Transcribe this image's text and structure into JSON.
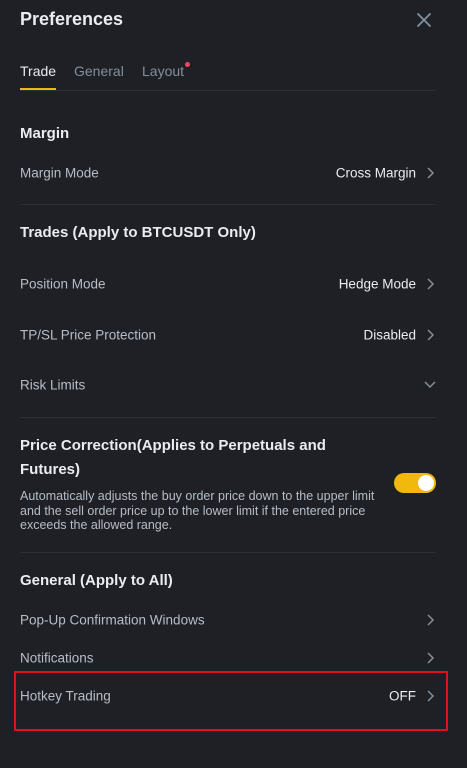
{
  "header": {
    "title": "Preferences",
    "close_icon": "close-icon"
  },
  "tabs": [
    {
      "label": "Trade",
      "active": true
    },
    {
      "label": "General",
      "active": false
    },
    {
      "label": "Layout",
      "active": false,
      "has_dot": true
    }
  ],
  "sections": {
    "margin": {
      "title": "Margin",
      "rows": [
        {
          "label": "Margin Mode",
          "value": "Cross Margin"
        }
      ]
    },
    "trades": {
      "title": "Trades (Apply to BTCUSDT Only)",
      "rows": [
        {
          "label": "Position Mode",
          "value": "Hedge Mode"
        },
        {
          "label": "TP/SL Price Protection",
          "value": "Disabled"
        },
        {
          "label": "Risk Limits",
          "value": ""
        }
      ]
    },
    "price_correction": {
      "title": "Price Correction(Applies to Perpetuals and Futures)",
      "description": "Automatically adjusts the buy order price down to the upper limit and the sell order price up to the lower limit if the entered price exceeds the allowed range.",
      "toggle_on": true
    },
    "general": {
      "title": "General (Apply to All)",
      "rows": [
        {
          "label": "Pop-Up Confirmation Windows",
          "value": ""
        },
        {
          "label": "Notifications",
          "value": ""
        },
        {
          "label": "Hotkey Trading",
          "value": "OFF"
        }
      ]
    }
  },
  "colors": {
    "background": "#1e2026",
    "accent": "#f0b90b",
    "notification_dot": "#f6465d",
    "highlight_border": "#e0111b"
  }
}
